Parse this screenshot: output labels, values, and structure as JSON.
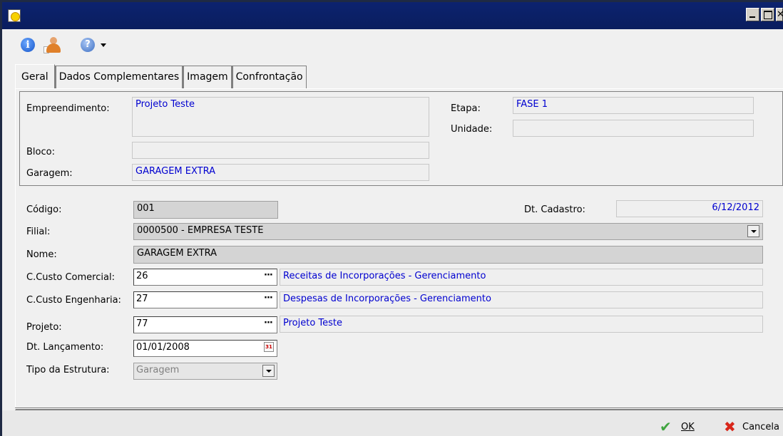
{
  "window": {
    "title": ""
  },
  "toolbar": {
    "icons": [
      "info-icon",
      "user-icon",
      "help-icon"
    ]
  },
  "tabs": [
    {
      "label": "Geral",
      "active": true
    },
    {
      "label": "Dados Complementares",
      "active": false
    },
    {
      "label": "Imagem",
      "active": false
    },
    {
      "label": "Confrontação",
      "active": false
    }
  ],
  "group": {
    "empreendimento_label": "Empreendimento:",
    "empreendimento_value": "Projeto Teste",
    "etapa_label": "Etapa:",
    "etapa_value": "FASE 1",
    "unidade_label": "Unidade:",
    "unidade_value": "",
    "bloco_label": "Bloco:",
    "bloco_value": "",
    "garagem_label": "Garagem:",
    "garagem_value": "GARAGEM EXTRA"
  },
  "form": {
    "codigo_label": "Código:",
    "codigo_value": "001",
    "dt_cadastro_label": "Dt. Cadastro:",
    "dt_cadastro_value": "6/12/2012",
    "filial_label": "Filial:",
    "filial_value": "0000500 - EMPRESA TESTE",
    "nome_label": "Nome:",
    "nome_value": "GARAGEM EXTRA",
    "cc_comercial_label": "C.Custo Comercial:",
    "cc_comercial_value": "26",
    "cc_comercial_desc": "Receitas de Incorporações - Gerenciamento",
    "cc_engenharia_label": "C.Custo Engenharia:",
    "cc_engenharia_value": "27",
    "cc_engenharia_desc": "Despesas de Incorporações - Gerenciamento",
    "projeto_label": "Projeto:",
    "projeto_value": "77",
    "projeto_desc": "Projeto Teste",
    "dt_lancamento_label": "Dt. Lançamento:",
    "dt_lancamento_value": "01/01/2008",
    "tipo_estrutura_label": "Tipo da Estrutura:",
    "tipo_estrutura_value": "Garagem",
    "ellipsis": "···"
  },
  "footer": {
    "ok_label": "OK",
    "cancel_label": "Cancela"
  },
  "colors": {
    "titlebar": "#0c236f",
    "link_text": "#0000d0",
    "ok_icon": "#3fa43f",
    "cancel_icon": "#d8261a"
  }
}
